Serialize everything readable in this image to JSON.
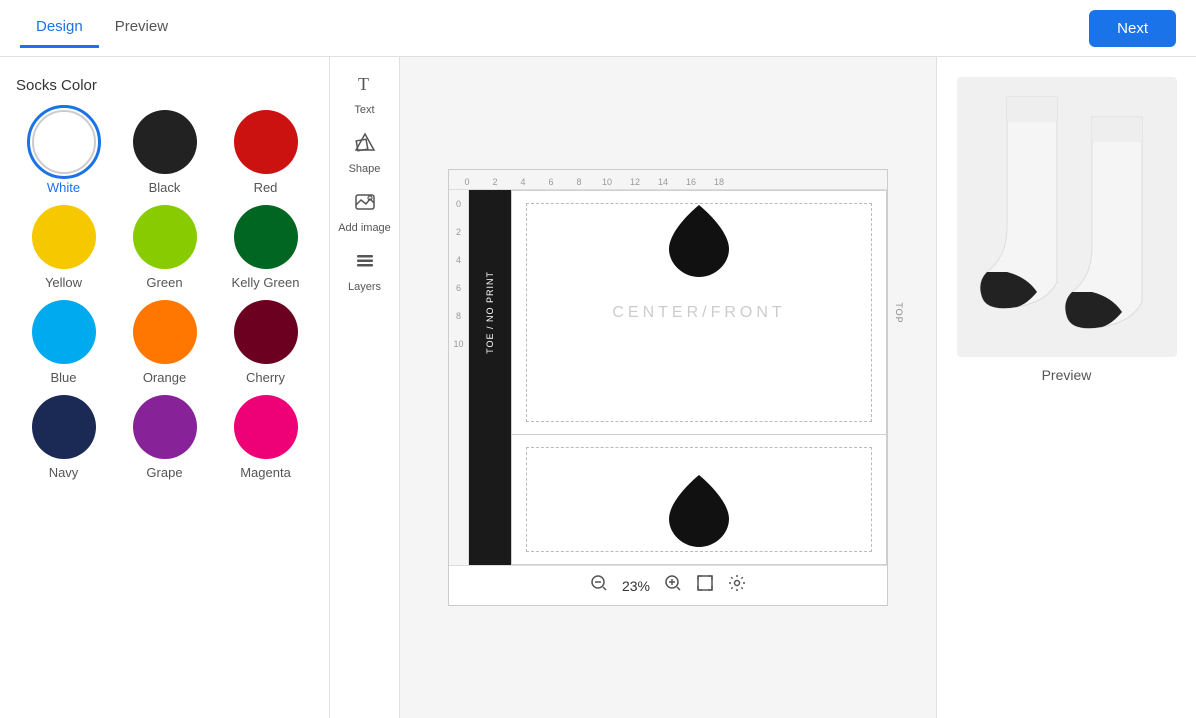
{
  "header": {
    "tabs": [
      {
        "label": "Design",
        "active": true
      },
      {
        "label": "Preview",
        "active": false
      }
    ],
    "next_button": "Next"
  },
  "left_panel": {
    "title": "Socks Color",
    "colors": [
      {
        "name": "White",
        "hex": "#ffffff",
        "selected": true,
        "border": "#ccc"
      },
      {
        "name": "Black",
        "hex": "#222222",
        "selected": false,
        "border": ""
      },
      {
        "name": "Red",
        "hex": "#cc1111",
        "selected": false,
        "border": ""
      },
      {
        "name": "Yellow",
        "hex": "#f5c800",
        "selected": false,
        "border": ""
      },
      {
        "name": "Green",
        "hex": "#88cc00",
        "selected": false,
        "border": ""
      },
      {
        "name": "Kelly Green",
        "hex": "#006622",
        "selected": false,
        "border": ""
      },
      {
        "name": "Blue",
        "hex": "#00aaee",
        "selected": false,
        "border": ""
      },
      {
        "name": "Orange",
        "hex": "#ff7700",
        "selected": false,
        "border": ""
      },
      {
        "name": "Cherry",
        "hex": "#6b0020",
        "selected": false,
        "border": ""
      },
      {
        "name": "Navy",
        "hex": "#1a2a55",
        "selected": false,
        "border": ""
      },
      {
        "name": "Grape",
        "hex": "#882299",
        "selected": false,
        "border": ""
      },
      {
        "name": "Magenta",
        "hex": "#ee0077",
        "selected": false,
        "border": ""
      }
    ]
  },
  "tools": [
    {
      "icon": "T",
      "label": "Text",
      "unicode": "T"
    },
    {
      "icon": "◇",
      "label": "Shape",
      "unicode": "◇"
    },
    {
      "icon": "⬜",
      "label": "Add image",
      "unicode": "🖼"
    },
    {
      "icon": "≡",
      "label": "Layers",
      "unicode": "≡"
    }
  ],
  "canvas": {
    "ruler_nums": [
      "0",
      "2",
      "4",
      "6",
      "8",
      "10",
      "12",
      "14",
      "16",
      "18"
    ],
    "center_label": "CENTER/FRONT",
    "toe_label": "TOE / NO PRINT",
    "top_label": "TOP",
    "zoom": "23%"
  },
  "zoom_bar": {
    "zoom_out": "−",
    "zoom_in": "+",
    "value": "23%"
  },
  "preview": {
    "label": "Preview"
  }
}
